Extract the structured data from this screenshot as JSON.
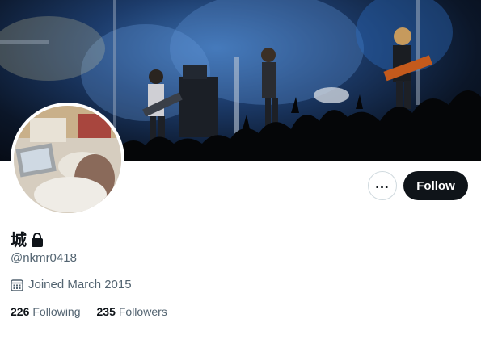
{
  "profile": {
    "display_name": "城",
    "handle": "@nkmr0418",
    "joined": "Joined March 2015",
    "following_count": "226",
    "following_label": "Following",
    "followers_count": "235",
    "followers_label": "Followers"
  },
  "actions": {
    "more_label": "…",
    "follow_label": "Follow"
  },
  "icons": {
    "lock": "lock-icon",
    "calendar": "calendar-icon",
    "more": "more-icon"
  },
  "colors": {
    "primary_text": "#0f1419",
    "secondary_text": "#536471",
    "follow_button_bg": "#0f1419",
    "border": "#cfd9de"
  }
}
